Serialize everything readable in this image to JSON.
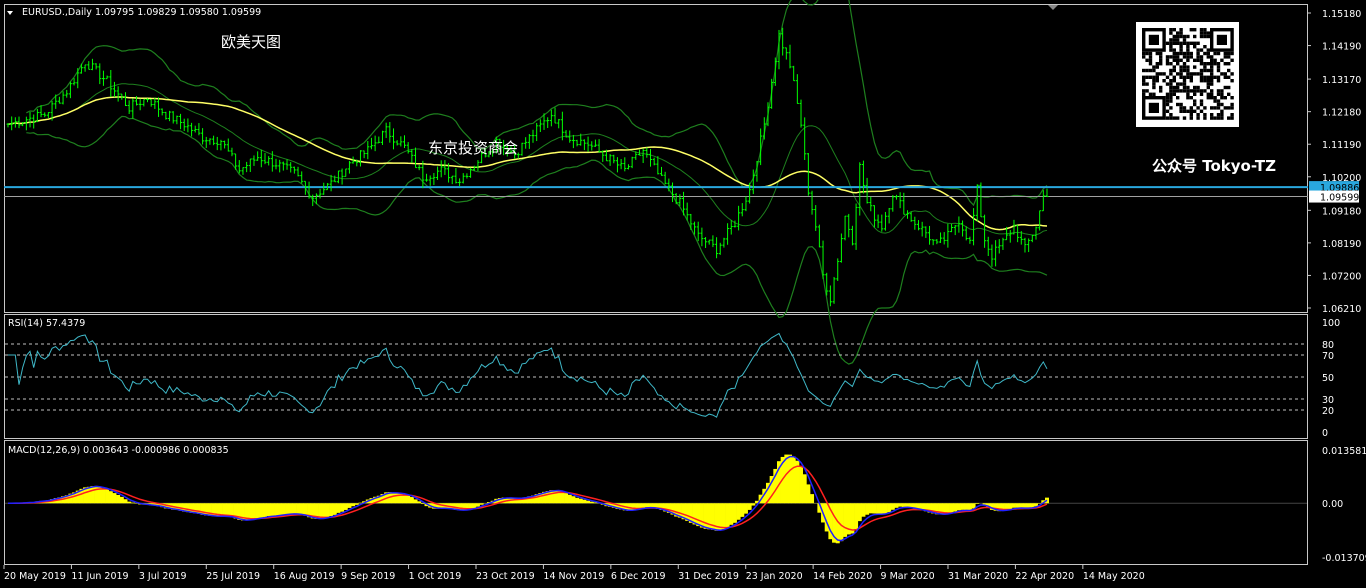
{
  "watermarks": {
    "top_left": "欧美天图",
    "center": "东京投资商会",
    "right": "公众号 Tokyo-TZ"
  },
  "colors": {
    "background": "#000000",
    "candles": "#00ff00",
    "bollinger": "#1e7f1e",
    "ma": "#ffff66",
    "hline": "#29a7de",
    "rsi": "#3fb8c8",
    "macd_hist": "#ffff00",
    "macd_line": "#2020ff",
    "signal_line": "#ff2020",
    "grid": "#c0c0c0"
  },
  "chart_data": [
    {
      "type": "candlestick",
      "title": "EURUSD.,Daily  1.09795 1.09829 1.09580 1.09599",
      "ylim": [
        1.0621,
        1.1518
      ],
      "yticks": [
        "1.15180",
        "1.14190",
        "1.13170",
        "1.12180",
        "1.11190",
        "1.10200",
        "1.09180",
        "1.08190",
        "1.07200",
        "1.06210"
      ],
      "price_labels": [
        {
          "name": "blue line",
          "value": "1.09886"
        },
        {
          "name": "last",
          "value": "1.09599"
        }
      ],
      "xtick_labels": [
        "20 May 2019",
        "11 Jun 2019",
        "3 Jul 2019",
        "25 Jul 2019",
        "16 Aug 2019",
        "9 Sep 2019",
        "1 Oct 2019",
        "23 Oct 2019",
        "14 Nov 2019",
        "6 Dec 2019",
        "31 Dec 2019",
        "23 Jan 2020",
        "14 Feb 2020",
        "9 Mar 2020",
        "31 Mar 2020",
        "22 Apr 2020",
        "14 May 2020"
      ],
      "close_keypoints": [
        [
          0,
          1.118
        ],
        [
          10,
          1.121
        ],
        [
          16,
          1.128
        ],
        [
          21,
          1.137
        ],
        [
          27,
          1.131
        ],
        [
          33,
          1.123
        ],
        [
          38,
          1.126
        ],
        [
          43,
          1.121
        ],
        [
          48,
          1.118
        ],
        [
          53,
          1.114
        ],
        [
          58,
          1.113
        ],
        [
          63,
          1.104
        ],
        [
          68,
          1.108
        ],
        [
          73,
          1.106
        ],
        [
          78,
          1.103
        ],
        [
          83,
          1.096
        ],
        [
          88,
          1.1
        ],
        [
          93,
          1.106
        ],
        [
          98,
          1.11
        ],
        [
          103,
          1.116
        ],
        [
          108,
          1.111
        ],
        [
          113,
          1.102
        ],
        [
          118,
          1.104
        ],
        [
          123,
          1.101
        ],
        [
          128,
          1.107
        ],
        [
          133,
          1.113
        ],
        [
          138,
          1.109
        ],
        [
          143,
          1.115
        ],
        [
          148,
          1.121
        ],
        [
          153,
          1.114
        ],
        [
          158,
          1.112
        ],
        [
          163,
          1.108
        ],
        [
          168,
          1.104
        ],
        [
          173,
          1.11
        ],
        [
          178,
          1.101
        ],
        [
          183,
          1.094
        ],
        [
          188,
          1.084
        ],
        [
          193,
          1.08
        ],
        [
          198,
          1.088
        ],
        [
          202,
          1.098
        ],
        [
          206,
          1.118
        ],
        [
          208,
          1.131
        ],
        [
          210,
          1.145
        ],
        [
          213,
          1.136
        ],
        [
          216,
          1.118
        ],
        [
          218,
          1.098
        ],
        [
          220,
          1.087
        ],
        [
          222,
          1.072
        ],
        [
          224,
          1.065
        ],
        [
          226,
          1.077
        ],
        [
          228,
          1.09
        ],
        [
          230,
          1.083
        ],
        [
          232,
          1.105
        ],
        [
          234,
          1.094
        ],
        [
          236,
          1.09
        ],
        [
          238,
          1.087
        ],
        [
          241,
          1.097
        ],
        [
          244,
          1.092
        ],
        [
          247,
          1.088
        ],
        [
          250,
          1.085
        ],
        [
          253,
          1.081
        ],
        [
          256,
          1.084
        ],
        [
          259,
          1.089
        ],
        [
          262,
          1.082
        ],
        [
          264,
          1.098
        ],
        [
          266,
          1.083
        ],
        [
          268,
          1.078
        ],
        [
          271,
          1.082
        ],
        [
          274,
          1.087
        ],
        [
          277,
          1.08
        ],
        [
          280,
          1.087
        ],
        [
          282,
          1.096
        ],
        [
          283,
          1.096
        ]
      ],
      "series": [
        {
          "name": "MA(50)"
        },
        {
          "name": "Bollinger Bands"
        }
      ]
    },
    {
      "type": "line",
      "title": "RSI(14) 57.4379",
      "ylim": [
        0,
        100
      ],
      "yticks": [
        "100",
        "80",
        "70",
        "50",
        "30",
        "20",
        "0"
      ],
      "levels": [
        80,
        70,
        50,
        30,
        20
      ],
      "last_value": 57.4379
    },
    {
      "type": "histogram+line",
      "title": "MACD(12,26,9) 0.003643 -0.000986 0.000835",
      "ylim": [
        -0.013709,
        0.013581
      ],
      "yticks": [
        "0.013581",
        "0.00",
        "-0.013709"
      ],
      "last_values": {
        "macd": 0.003643,
        "signal": -0.000986,
        "hist": 0.000835
      }
    }
  ]
}
